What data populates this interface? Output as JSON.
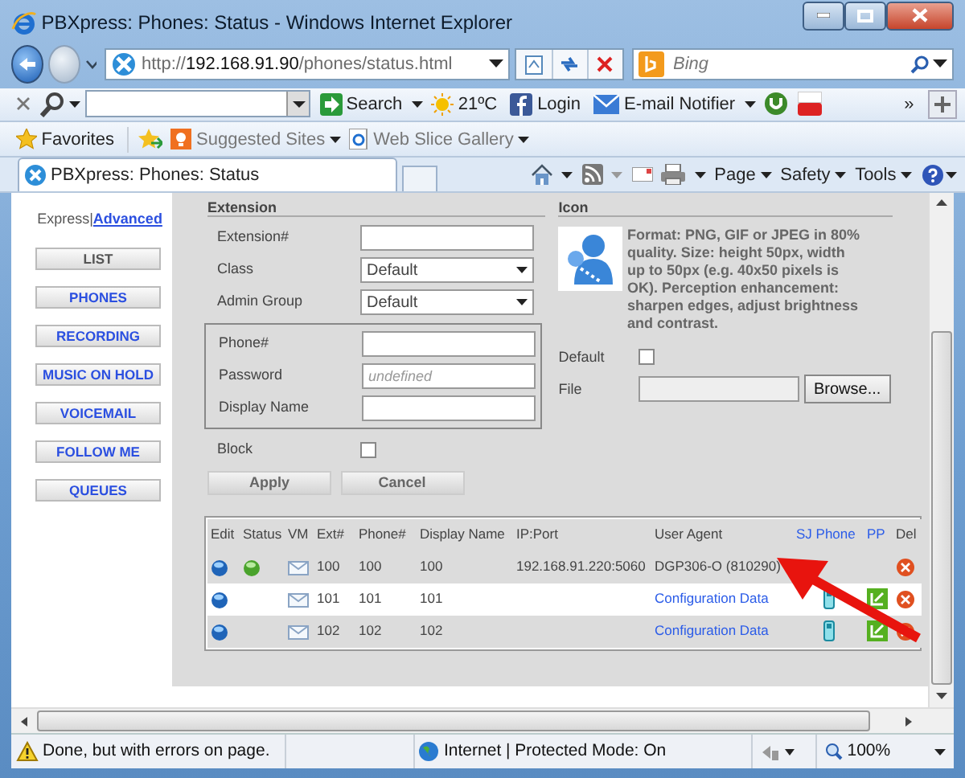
{
  "window": {
    "title": "PBXpress: Phones: Status - Windows Internet Explorer"
  },
  "address_bar": {
    "url": "http://**192.168.91.90**/phones/status.html"
  },
  "search_box": {
    "placeholder": "Bing"
  },
  "toolbar": {
    "search_button": "Search",
    "weather": "21ºC",
    "login": "Login",
    "email": "E-mail Notifier",
    "more": "»"
  },
  "favorites_bar": {
    "favorites": "Favorites",
    "suggested_sites": "Suggested Sites",
    "web_slice_gallery": "Web Slice Gallery"
  },
  "tab": {
    "title": "PBXpress: Phones: Status"
  },
  "command_bar": {
    "page": "Page",
    "safety": "Safety",
    "tools": "Tools"
  },
  "sidebar": {
    "mode_links": [
      {
        "label": "Express",
        "selected": false
      },
      {
        "label": "Advanced",
        "selected": true
      }
    ],
    "separator": "|",
    "items": [
      {
        "label": "LIST",
        "selected": true
      },
      {
        "label": "PHONES",
        "selected": false
      },
      {
        "label": "RECORDING",
        "selected": false
      },
      {
        "label": "MUSIC ON HOLD",
        "selected": false
      },
      {
        "label": "VOICEMAIL",
        "selected": false
      },
      {
        "label": "FOLLOW ME",
        "selected": false
      },
      {
        "label": "QUEUES",
        "selected": false
      }
    ]
  },
  "extension": {
    "heading": "Extension",
    "fields": [
      {
        "label": "Extension#",
        "kind": "text"
      },
      {
        "label": "Class",
        "kind": "select",
        "value": "Default"
      },
      {
        "label": "Admin Group",
        "kind": "select",
        "value": "Default"
      }
    ],
    "account_fields": [
      {
        "label": "Phone#",
        "kind": "text"
      },
      {
        "label": "Password",
        "kind": "text",
        "placeholder": "undefined"
      },
      {
        "label": "Display Name",
        "kind": "text"
      }
    ],
    "block": {
      "label": "Block",
      "checked": false
    },
    "buttons": [
      "Apply",
      "Cancel"
    ]
  },
  "icon_section": {
    "heading": "Icon",
    "description": "Format: PNG, GIF or JPEG in 80% quality. Size: height 50px, width up to 50px (e.g. 40x50 pixels is OK). Perception enhancement: sharpen edges, adjust brightness and contrast.",
    "default": {
      "label": "Default",
      "checked": false
    },
    "file": {
      "label": "File"
    },
    "browse_button": "Browse..."
  },
  "phones_table": {
    "columns": [
      {
        "label": "Edit",
        "link": false
      },
      {
        "label": "Status",
        "link": false
      },
      {
        "label": "VM",
        "link": false
      },
      {
        "label": "Ext#",
        "link": false
      },
      {
        "label": "Phone#",
        "link": false
      },
      {
        "label": "Display Name",
        "link": false
      },
      {
        "label": "IP:Port",
        "link": false
      },
      {
        "label": "User Agent",
        "link": false
      },
      {
        "label": "SJ Phone",
        "link": true
      },
      {
        "label": "PP",
        "link": true
      },
      {
        "label": "Del",
        "link": false
      }
    ],
    "rows": [
      {
        "online": true,
        "ext": "100",
        "phone": "100",
        "display_name": "100",
        "ip_port": "192.168.91.220:5060",
        "user_agent": {
          "kind": "text",
          "text": "DGP306-O (810290)"
        },
        "sj_phone": false,
        "pp": false
      },
      {
        "online": false,
        "ext": "101",
        "phone": "101",
        "display_name": "101",
        "user_agent": {
          "kind": "link",
          "text": "Configuration Data"
        },
        "sj_phone": true,
        "pp": true
      },
      {
        "online": false,
        "ext": "102",
        "phone": "102",
        "display_name": "102",
        "user_agent": {
          "kind": "link",
          "text": "Configuration Data"
        },
        "sj_phone": true,
        "pp": true
      }
    ]
  },
  "status_bar": {
    "message": "Done, but with errors on page.",
    "zone": "Internet | Protected Mode: On",
    "zoom": "100%"
  }
}
